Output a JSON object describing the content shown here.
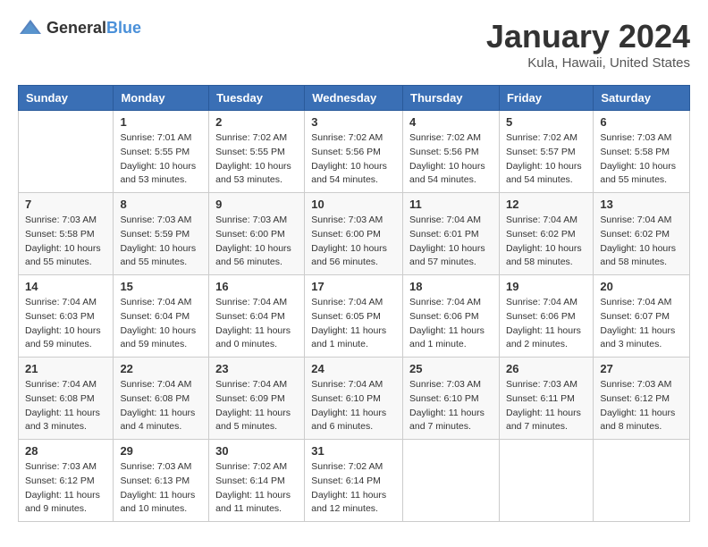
{
  "header": {
    "logo_general": "General",
    "logo_blue": "Blue",
    "month_year": "January 2024",
    "location": "Kula, Hawaii, United States"
  },
  "days_of_week": [
    "Sunday",
    "Monday",
    "Tuesday",
    "Wednesday",
    "Thursday",
    "Friday",
    "Saturday"
  ],
  "weeks": [
    [
      {
        "day": "",
        "info": ""
      },
      {
        "day": "1",
        "info": "Sunrise: 7:01 AM\nSunset: 5:55 PM\nDaylight: 10 hours\nand 53 minutes."
      },
      {
        "day": "2",
        "info": "Sunrise: 7:02 AM\nSunset: 5:55 PM\nDaylight: 10 hours\nand 53 minutes."
      },
      {
        "day": "3",
        "info": "Sunrise: 7:02 AM\nSunset: 5:56 PM\nDaylight: 10 hours\nand 54 minutes."
      },
      {
        "day": "4",
        "info": "Sunrise: 7:02 AM\nSunset: 5:56 PM\nDaylight: 10 hours\nand 54 minutes."
      },
      {
        "day": "5",
        "info": "Sunrise: 7:02 AM\nSunset: 5:57 PM\nDaylight: 10 hours\nand 54 minutes."
      },
      {
        "day": "6",
        "info": "Sunrise: 7:03 AM\nSunset: 5:58 PM\nDaylight: 10 hours\nand 55 minutes."
      }
    ],
    [
      {
        "day": "7",
        "info": "Sunrise: 7:03 AM\nSunset: 5:58 PM\nDaylight: 10 hours\nand 55 minutes."
      },
      {
        "day": "8",
        "info": "Sunrise: 7:03 AM\nSunset: 5:59 PM\nDaylight: 10 hours\nand 55 minutes."
      },
      {
        "day": "9",
        "info": "Sunrise: 7:03 AM\nSunset: 6:00 PM\nDaylight: 10 hours\nand 56 minutes."
      },
      {
        "day": "10",
        "info": "Sunrise: 7:03 AM\nSunset: 6:00 PM\nDaylight: 10 hours\nand 56 minutes."
      },
      {
        "day": "11",
        "info": "Sunrise: 7:04 AM\nSunset: 6:01 PM\nDaylight: 10 hours\nand 57 minutes."
      },
      {
        "day": "12",
        "info": "Sunrise: 7:04 AM\nSunset: 6:02 PM\nDaylight: 10 hours\nand 58 minutes."
      },
      {
        "day": "13",
        "info": "Sunrise: 7:04 AM\nSunset: 6:02 PM\nDaylight: 10 hours\nand 58 minutes."
      }
    ],
    [
      {
        "day": "14",
        "info": "Sunrise: 7:04 AM\nSunset: 6:03 PM\nDaylight: 10 hours\nand 59 minutes."
      },
      {
        "day": "15",
        "info": "Sunrise: 7:04 AM\nSunset: 6:04 PM\nDaylight: 10 hours\nand 59 minutes."
      },
      {
        "day": "16",
        "info": "Sunrise: 7:04 AM\nSunset: 6:04 PM\nDaylight: 11 hours\nand 0 minutes."
      },
      {
        "day": "17",
        "info": "Sunrise: 7:04 AM\nSunset: 6:05 PM\nDaylight: 11 hours\nand 1 minute."
      },
      {
        "day": "18",
        "info": "Sunrise: 7:04 AM\nSunset: 6:06 PM\nDaylight: 11 hours\nand 1 minute."
      },
      {
        "day": "19",
        "info": "Sunrise: 7:04 AM\nSunset: 6:06 PM\nDaylight: 11 hours\nand 2 minutes."
      },
      {
        "day": "20",
        "info": "Sunrise: 7:04 AM\nSunset: 6:07 PM\nDaylight: 11 hours\nand 3 minutes."
      }
    ],
    [
      {
        "day": "21",
        "info": "Sunrise: 7:04 AM\nSunset: 6:08 PM\nDaylight: 11 hours\nand 3 minutes."
      },
      {
        "day": "22",
        "info": "Sunrise: 7:04 AM\nSunset: 6:08 PM\nDaylight: 11 hours\nand 4 minutes."
      },
      {
        "day": "23",
        "info": "Sunrise: 7:04 AM\nSunset: 6:09 PM\nDaylight: 11 hours\nand 5 minutes."
      },
      {
        "day": "24",
        "info": "Sunrise: 7:04 AM\nSunset: 6:10 PM\nDaylight: 11 hours\nand 6 minutes."
      },
      {
        "day": "25",
        "info": "Sunrise: 7:03 AM\nSunset: 6:10 PM\nDaylight: 11 hours\nand 7 minutes."
      },
      {
        "day": "26",
        "info": "Sunrise: 7:03 AM\nSunset: 6:11 PM\nDaylight: 11 hours\nand 7 minutes."
      },
      {
        "day": "27",
        "info": "Sunrise: 7:03 AM\nSunset: 6:12 PM\nDaylight: 11 hours\nand 8 minutes."
      }
    ],
    [
      {
        "day": "28",
        "info": "Sunrise: 7:03 AM\nSunset: 6:12 PM\nDaylight: 11 hours\nand 9 minutes."
      },
      {
        "day": "29",
        "info": "Sunrise: 7:03 AM\nSunset: 6:13 PM\nDaylight: 11 hours\nand 10 minutes."
      },
      {
        "day": "30",
        "info": "Sunrise: 7:02 AM\nSunset: 6:14 PM\nDaylight: 11 hours\nand 11 minutes."
      },
      {
        "day": "31",
        "info": "Sunrise: 7:02 AM\nSunset: 6:14 PM\nDaylight: 11 hours\nand 12 minutes."
      },
      {
        "day": "",
        "info": ""
      },
      {
        "day": "",
        "info": ""
      },
      {
        "day": "",
        "info": ""
      }
    ]
  ]
}
